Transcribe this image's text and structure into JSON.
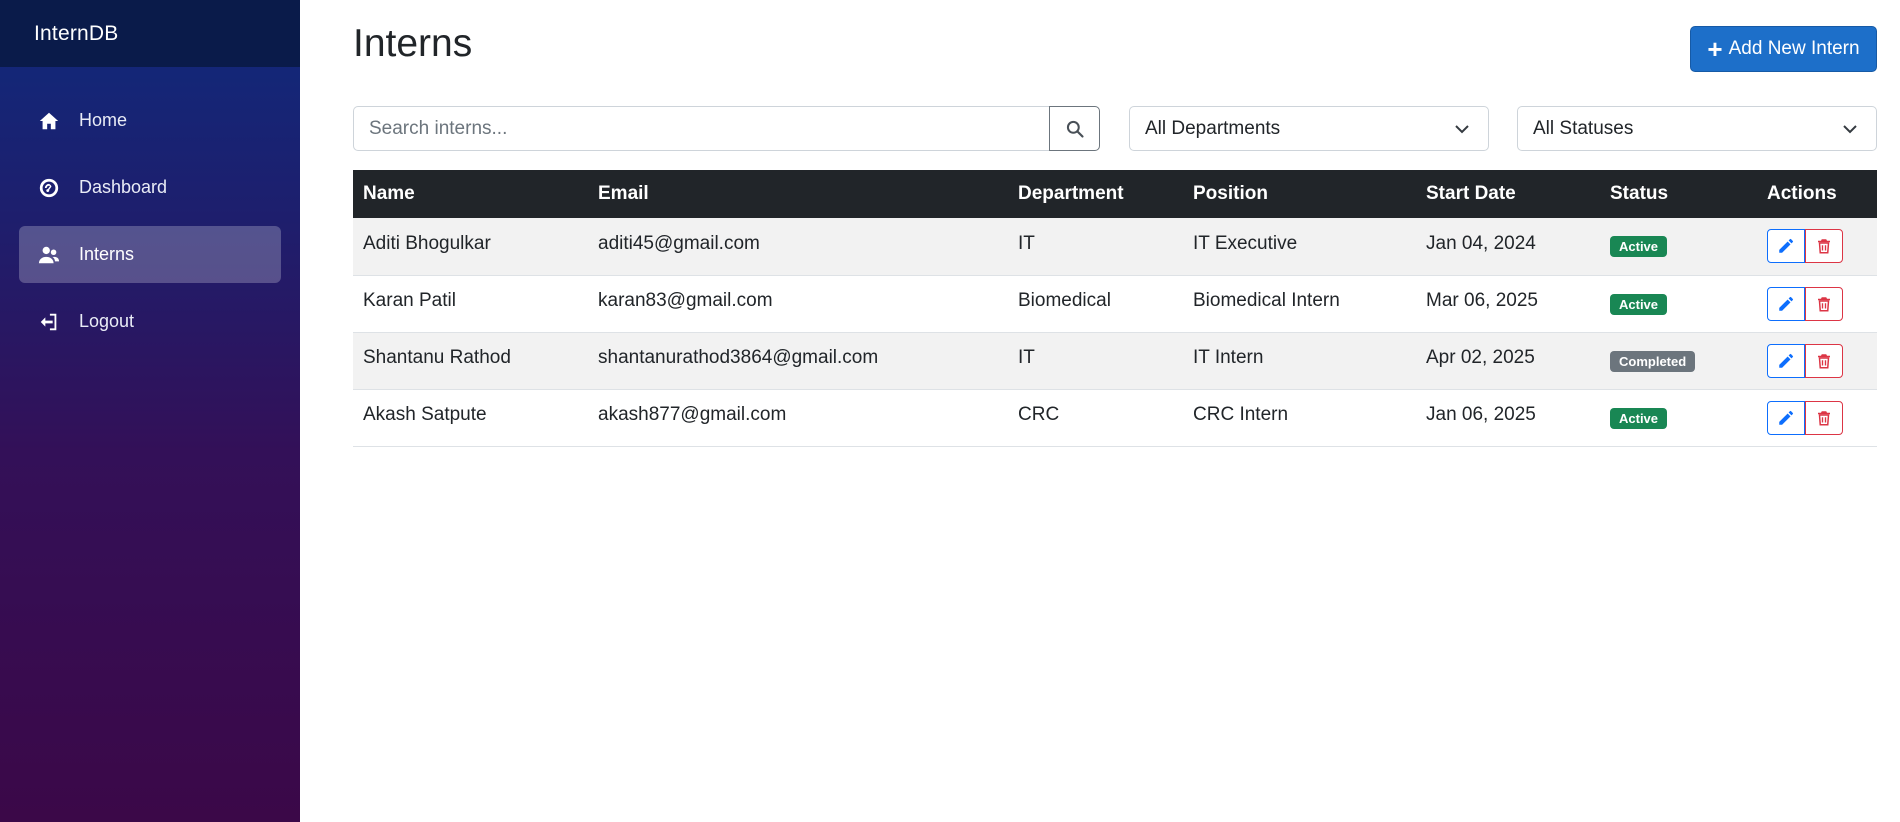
{
  "app": {
    "brand": "InternDB"
  },
  "sidebar": {
    "items": [
      {
        "label": "Home",
        "icon": "home-icon",
        "active": false
      },
      {
        "label": "Dashboard",
        "icon": "dashboard-icon",
        "active": false
      },
      {
        "label": "Interns",
        "icon": "users-icon",
        "active": true
      },
      {
        "label": "Logout",
        "icon": "logout-icon",
        "active": false
      }
    ]
  },
  "header": {
    "title": "Interns",
    "add_button_label": "Add New Intern"
  },
  "filters": {
    "search_placeholder": "Search interns...",
    "department_selected": "All Departments",
    "status_selected": "All Statuses"
  },
  "table": {
    "columns": [
      "Name",
      "Email",
      "Department",
      "Position",
      "Start Date",
      "Status",
      "Actions"
    ],
    "rows": [
      {
        "name": "Aditi Bhogulkar",
        "email": "aditi45@gmail.com",
        "department": "IT",
        "position": "IT Executive",
        "start_date": "Jan 04, 2024",
        "status": "Active"
      },
      {
        "name": "Karan Patil",
        "email": "karan83@gmail.com",
        "department": "Biomedical",
        "position": "Biomedical Intern",
        "start_date": "Mar 06, 2025",
        "status": "Active"
      },
      {
        "name": "Shantanu Rathod",
        "email": "shantanurathod3864@gmail.com",
        "department": "IT",
        "position": "IT Intern",
        "start_date": "Apr 02, 2025",
        "status": "Completed"
      },
      {
        "name": "Akash Satpute",
        "email": "akash877@gmail.com",
        "department": "CRC",
        "position": "CRC Intern",
        "start_date": "Jan 06, 2025",
        "status": "Active"
      }
    ]
  },
  "colors": {
    "primary": "#1d6fc9",
    "active_badge": "#198754",
    "completed_badge": "#6c757d",
    "edit": "#0d6efd",
    "delete": "#dc3545",
    "table_header": "#212529"
  }
}
